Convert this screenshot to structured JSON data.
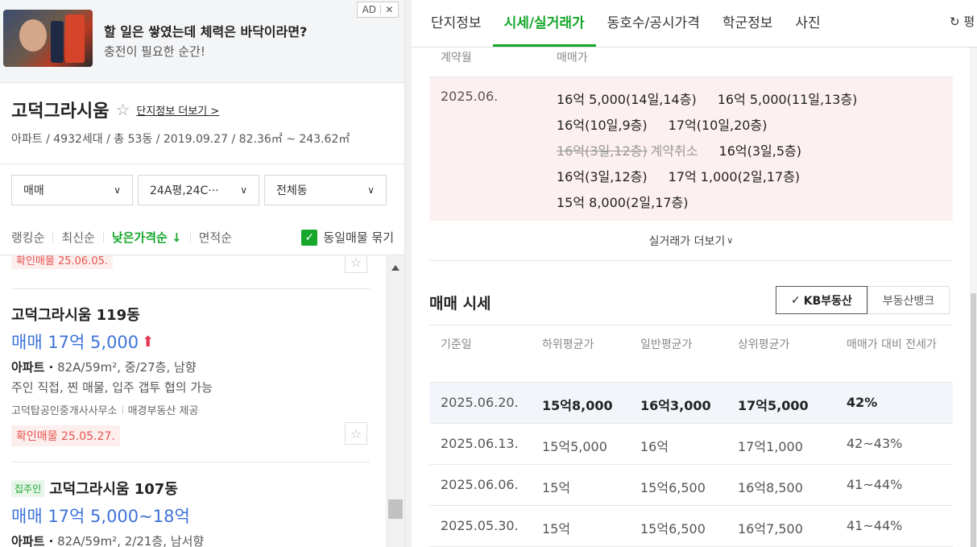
{
  "ad": {
    "title": "할 일은 쌓였는데 체력은 바닥이라면?",
    "subtitle": "충전이 필요한 순간!",
    "badge": "AD",
    "close": "✕"
  },
  "complex": {
    "name": "고덕그라시움",
    "star": "☆",
    "more_label": "단지정보 더보기 >",
    "info": "아파트 / 4932세대 / 총 53동 / 2019.09.27 / 82.36㎡ ~ 243.62㎡"
  },
  "filters": {
    "trade_type": "매매",
    "size": "24A평,24C···",
    "building": "전체동",
    "chevron": "∨"
  },
  "sort": {
    "ranking": "랭킹순",
    "latest": "최신순",
    "lowest_price": "낮은가격순 ↓",
    "area": "면적순",
    "group_label": "동일매물 묶기",
    "check": "✓"
  },
  "listings": {
    "cut_tag": "확인매물 25.06.05.",
    "items": [
      {
        "title": "고덕그라시움 119동",
        "price": "매매 17억 5,000",
        "arrow": "⬆",
        "spec_type": "아파트 ·",
        "spec": " 82A/59m², 중/27층, 남향",
        "desc": "주인 직접, 찐 매물, 입주 갭투 협의 가능",
        "agent": "고덕탑공인중개사사무소",
        "provider": "매경부동산 제공",
        "verified": "확인매물 25.05.27.",
        "fav": "☆"
      },
      {
        "owner_tag": "집주인",
        "title": "고덕그라시움 107동",
        "price": "매매 17억 5,000~18억",
        "spec_type": "아파트 ·",
        "spec": " 82A/59m², 2/21층, 남서향",
        "fav": "☆"
      }
    ]
  },
  "tabs": {
    "items": [
      "단지정보",
      "시세/실거래가",
      "동호수/공시가격",
      "학군정보",
      "사진"
    ],
    "active": "시세/실거래가",
    "refresh": "↻ 평"
  },
  "deals": {
    "header_month": "계약월",
    "header_price": "매매가",
    "month": "2025.06.",
    "lines": [
      [
        "16억 5,000(14일,14층)",
        "16억 5,000(11일,13층)"
      ],
      [
        "16억(10일,9층)",
        "17억(10일,20층)"
      ],
      [
        "16억(3일,12층)",
        "계약취소",
        "16억(3일,5층)"
      ],
      [
        "16억(3일,12층)",
        "17억 1,000(2일,17층)"
      ],
      [
        "15억 8,000(2일,17층)"
      ]
    ],
    "more": "실거래가 더보기"
  },
  "market": {
    "title": "매매 시세",
    "sources": [
      "KB부동산",
      "부동산뱅크"
    ],
    "active_source": "KB부동산",
    "check": "✓",
    "columns": [
      "기준일",
      "하위평균가",
      "일반평균가",
      "상위평균가",
      "매매가 대비 전세가"
    ],
    "rows": [
      [
        "2025.06.20.",
        "15억8,000",
        "16억3,000",
        "17억5,000",
        "42%"
      ],
      [
        "2025.06.13.",
        "15억5,000",
        "16억",
        "17억1,000",
        "42~43%"
      ],
      [
        "2025.06.06.",
        "15억",
        "15억6,500",
        "16억8,500",
        "41~44%"
      ],
      [
        "2025.05.30.",
        "15억",
        "15억6,500",
        "16억7,500",
        "41~44%"
      ]
    ]
  }
}
